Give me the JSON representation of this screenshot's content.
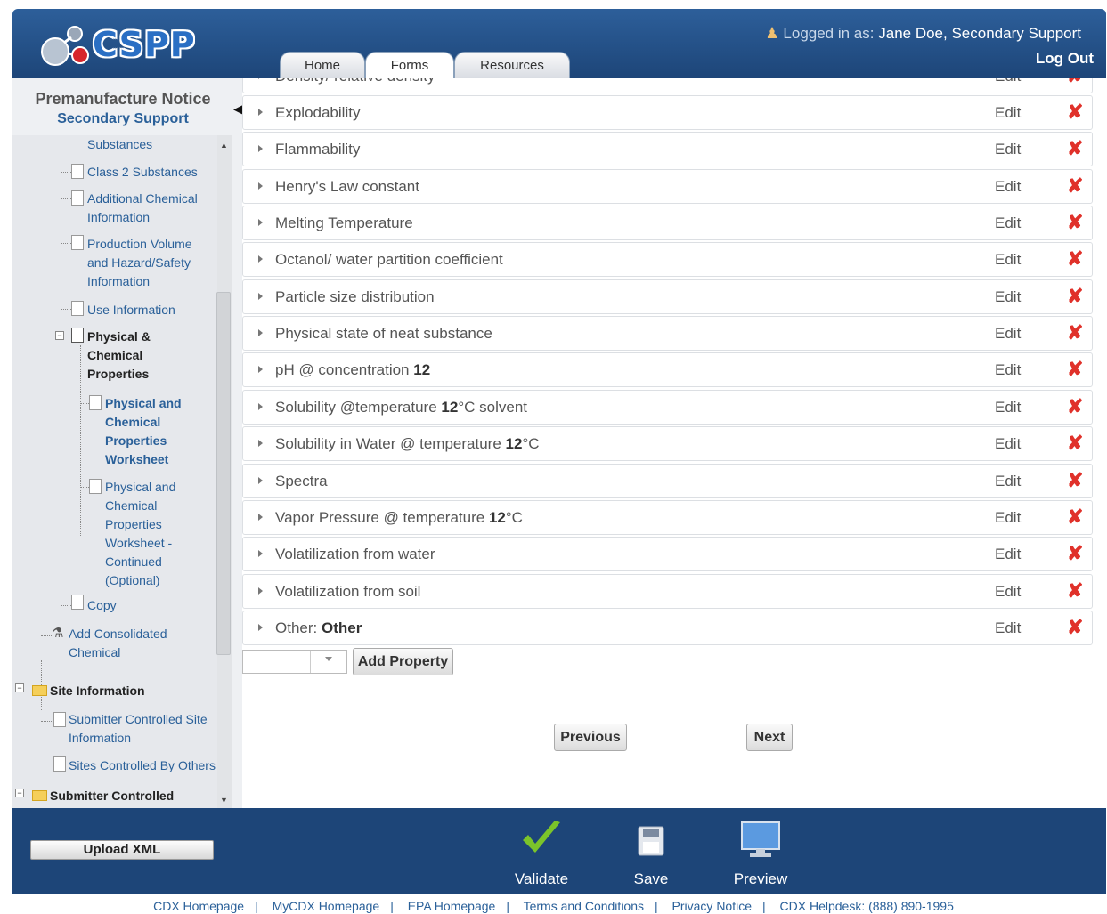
{
  "app": {
    "name": "CSPP"
  },
  "header": {
    "logged_in_label": "Logged in as:",
    "user": "Jane Doe, Secondary Support",
    "logout": "Log Out",
    "tabs": [
      "Home",
      "Forms",
      "Resources"
    ],
    "active_tab": "Forms"
  },
  "sidebar": {
    "title": "Premanufacture Notice",
    "subtitle": "Secondary Support",
    "tree": {
      "substances": "Substances",
      "class2": "Class 2 Substances",
      "additional1": "Additional Chemical",
      "additional2": "Information",
      "prod1": "Production Volume",
      "prod2": "and Hazard/Safety",
      "prod3": "Information",
      "use": "Use Information",
      "pc1": "Physical &",
      "pc2": "Chemical",
      "pc3": "Properties",
      "ws1": "Physical and",
      "ws2": "Chemical",
      "ws3": "Properties",
      "ws4": "Worksheet",
      "wsc1": "Physical and",
      "wsc2": "Chemical",
      "wsc3": "Properties",
      "wsc4": "Worksheet -",
      "wsc5": "Continued",
      "wsc6": "(Optional)",
      "copy": "Copy",
      "acc1": "Add Consolidated",
      "acc2": "Chemical",
      "site": "Site Information",
      "scs1": "Submitter Controlled Site",
      "scs2": "Information",
      "sco": "Sites Controlled By Others",
      "subctrl": "Submitter Controlled"
    }
  },
  "properties": {
    "partial_top": "Density/ relative density",
    "edit_label": "Edit",
    "items": [
      {
        "text": "Explodability"
      },
      {
        "text": "Flammability"
      },
      {
        "text": "Henry's Law constant"
      },
      {
        "text": "Melting Temperature"
      },
      {
        "text": "Octanol/ water partition coefficient"
      },
      {
        "text": "Particle size distribution"
      },
      {
        "text": "Physical state of neat substance"
      },
      {
        "pre": "pH @ concentration ",
        "bold": "12",
        "post": ""
      },
      {
        "pre": "Solubility @temperature ",
        "bold": "12",
        "post": "°C solvent"
      },
      {
        "pre": "Solubility in Water @ temperature ",
        "bold": "12",
        "post": "°C"
      },
      {
        "text": "Spectra"
      },
      {
        "pre": "Vapor Pressure @ temperature ",
        "bold": "12",
        "post": "°C"
      },
      {
        "text": "Volatilization from water"
      },
      {
        "text": "Volatilization from soil"
      },
      {
        "pre": "Other: ",
        "bold": "Other",
        "post": ""
      }
    ],
    "add_button": "Add Property"
  },
  "nav": {
    "previous": "Previous",
    "next": "Next"
  },
  "footer": {
    "upload": "Upload XML",
    "validate": "Validate",
    "save": "Save",
    "preview": "Preview",
    "links": [
      "CDX Homepage",
      "MyCDX Homepage",
      "EPA Homepage",
      "Terms and Conditions",
      "Privacy Notice",
      "CDX Helpdesk: (888) 890-1995"
    ]
  },
  "colors": {
    "header": "#1d4578",
    "delete": "#e0312a",
    "link": "#2a6099",
    "check": "#7bc42a"
  }
}
